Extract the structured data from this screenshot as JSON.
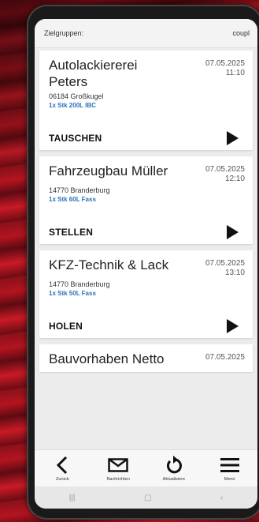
{
  "topbar": {
    "left": "Zielgruppen:",
    "right": "coupl"
  },
  "cards": [
    {
      "name": "Autolackiererei Peters",
      "date": "07.05.2025",
      "time": "11:10",
      "city": "06184 Großkugel",
      "qty": "1x Stk 200L IBC",
      "action": "TAUSCHEN"
    },
    {
      "name": "Fahrzeugbau Müller",
      "date": "07.05.2025",
      "time": "12:10",
      "city": "14770 Branderburg",
      "qty": "1x Stk 60L Fass",
      "action": "STELLEN"
    },
    {
      "name": "KFZ-Technik & Lack",
      "date": "07.05.2025",
      "time": "13:10",
      "city": "14770 Branderburg",
      "qty": "1x Stk 50L Fass",
      "action": "HOLEN"
    },
    {
      "name": "Bauvorhaben Netto",
      "date": "07.05.2025"
    }
  ],
  "bottomnav": {
    "back_label": "Zurück",
    "messages_label": "Nachrichten",
    "refresh_label": "Aktualisiere",
    "menu_label": "Menü"
  },
  "colors": {
    "accent_blue": "#2a72b8",
    "background_red": "#b3141f"
  },
  "icons": [
    "back-chevron-icon",
    "mail-icon",
    "refresh-icon",
    "menu-icon",
    "play-icon"
  ]
}
